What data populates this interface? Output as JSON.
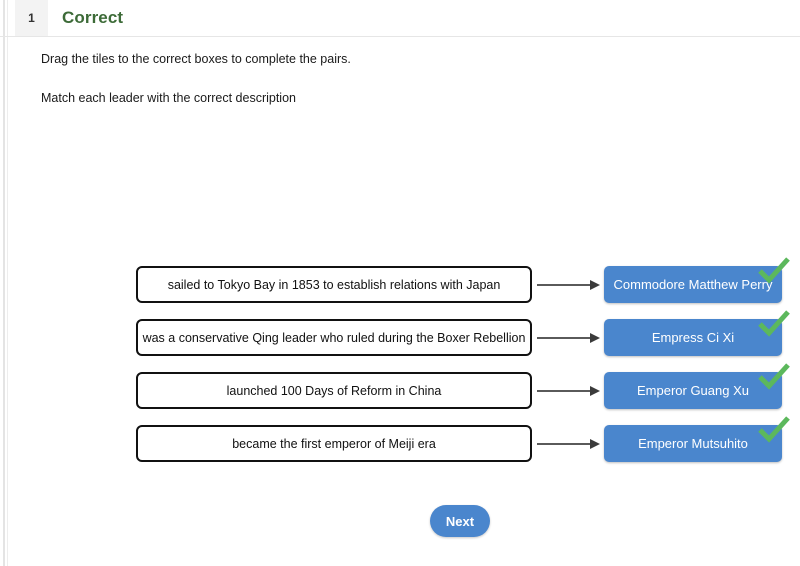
{
  "header": {
    "question_number": "1",
    "status": "Correct",
    "status_color": "#3d6b38"
  },
  "instructions": {
    "line1": "Drag the tiles to the correct boxes to complete the pairs.",
    "line2": "Match each leader with the correct description"
  },
  "colors": {
    "tile_blue": "#4a86cd",
    "check_green": "#5cb85c",
    "box_border": "#111111"
  },
  "matches": [
    {
      "description": "sailed to Tokyo Bay in 1853 to establish relations with Japan",
      "tile": "Commodore Matthew Perry",
      "check_icon": "check-mark-icon",
      "arrow_icon": "arrow-right-icon"
    },
    {
      "description": "was a conservative Qing leader who ruled during the Boxer Rebellion",
      "tile": "Empress Ci Xi",
      "check_icon": "check-mark-icon",
      "arrow_icon": "arrow-right-icon"
    },
    {
      "description": "launched 100 Days of Reform in China",
      "tile": "Emperor Guang Xu",
      "check_icon": "check-mark-icon",
      "arrow_icon": "arrow-right-icon"
    },
    {
      "description": "became the first emperor of Meiji era",
      "tile": "Emperor Mutsuhito",
      "check_icon": "check-mark-icon",
      "arrow_icon": "arrow-right-icon"
    }
  ],
  "footer": {
    "next_label": "Next"
  }
}
